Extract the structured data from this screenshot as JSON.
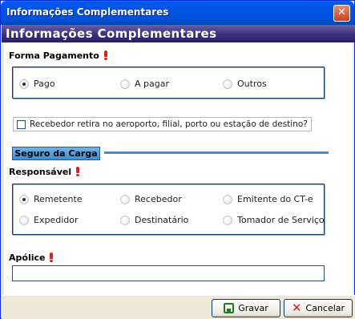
{
  "window": {
    "title": "Informações Complementares",
    "close_glyph": "✕"
  },
  "header": {
    "title": "Informações Complementares"
  },
  "payment": {
    "label": "Forma Pagamento",
    "options": [
      {
        "label": "Pago",
        "checked": true
      },
      {
        "label": "A pagar",
        "checked": false
      },
      {
        "label": "Outros",
        "checked": false
      }
    ]
  },
  "pickup_checkbox": {
    "label": "Recebedor retira no aeroporto, filial, porto ou estação de destino?",
    "checked": false
  },
  "insurance": {
    "section_title": "Seguro da Carga",
    "responsible_label": "Responsável",
    "options": [
      {
        "label": "Remetente",
        "checked": true
      },
      {
        "label": "Recebedor",
        "checked": false
      },
      {
        "label": "Emitente do CT-e",
        "checked": false
      },
      {
        "label": "Expedidor",
        "checked": false
      },
      {
        "label": "Destinatário",
        "checked": false
      },
      {
        "label": "Tomador de Serviço",
        "checked": false
      }
    ],
    "policy_label": "Apólice",
    "policy_value": ""
  },
  "footer": {
    "save_label": "Gravar",
    "cancel_label": "Cancelar"
  },
  "colors": {
    "titlebar": "#0054E3",
    "header_band": "#3C2F7E",
    "section_tag": "#3C8FD5",
    "required": "#E01E1E"
  },
  "icons": {
    "required": "required-icon",
    "save": "save-icon",
    "cancel": "cancel-icon"
  }
}
